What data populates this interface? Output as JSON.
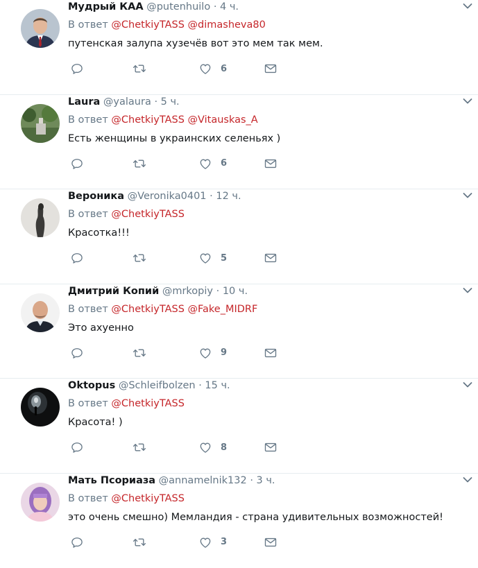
{
  "feed": {
    "tweets": [
      {
        "name": "Мудрый КАА",
        "handle": "@putenhuilo",
        "sep": "·",
        "time": "4 ч.",
        "reply_prefix": "В ответ",
        "mentions": [
          "@ChetkiyTASS",
          "@dimasheva80"
        ],
        "text": "путенская залупа хузечёв вот это мем так мем.",
        "likes": "6",
        "avatar": "suit-man-icon"
      },
      {
        "name": "Laura",
        "handle": "@yalaura",
        "sep": "·",
        "time": "5 ч.",
        "reply_prefix": "В ответ",
        "mentions": [
          "@ChetkiyTASS",
          "@Vitauskas_A"
        ],
        "text": "Есть женщины в украинских селеньях )",
        "likes": "6",
        "avatar": "garden-icon"
      },
      {
        "name": "Вероника",
        "handle": "@Veronika0401",
        "sep": "·",
        "time": "12 ч.",
        "reply_prefix": "В ответ",
        "mentions": [
          "@ChetkiyTASS"
        ],
        "text": "Красотка!!!",
        "likes": "5",
        "avatar": "sculpture-icon"
      },
      {
        "name": "Дмитрий Копий",
        "handle": "@mrkopiy",
        "sep": "·",
        "time": "10 ч.",
        "reply_prefix": "В ответ",
        "mentions": [
          "@ChetkiyTASS",
          "@Fake_MIDRF"
        ],
        "text": "Это ахуенно",
        "likes": "9",
        "avatar": "bald-man-icon"
      },
      {
        "name": "Oktopus",
        "handle": "@Schleifbolzen",
        "sep": "·",
        "time": "15 ч.",
        "reply_prefix": "В ответ",
        "mentions": [
          "@ChetkiyTASS"
        ],
        "text": "Красота! )",
        "likes": "8",
        "avatar": "dark-tunnel-icon"
      },
      {
        "name": "Мать Псориаза",
        "handle": "@annamelnik132",
        "sep": "·",
        "time": "3 ч.",
        "reply_prefix": "В ответ",
        "mentions": [
          "@ChetkiyTASS"
        ],
        "text": "это очень смешно) Мемландия - страна удивительных возможностей!",
        "likes": "3",
        "avatar": "girl-purple-hair-icon"
      }
    ]
  },
  "colors": {
    "mention": "#c5262a",
    "muted": "#657786",
    "text": "#14171a",
    "divider": "#e6ecf0"
  },
  "icons": {
    "reply": "reply-icon",
    "retweet": "retweet-icon",
    "like": "heart-icon",
    "dm": "envelope-icon",
    "menu": "chevron-down-icon"
  }
}
